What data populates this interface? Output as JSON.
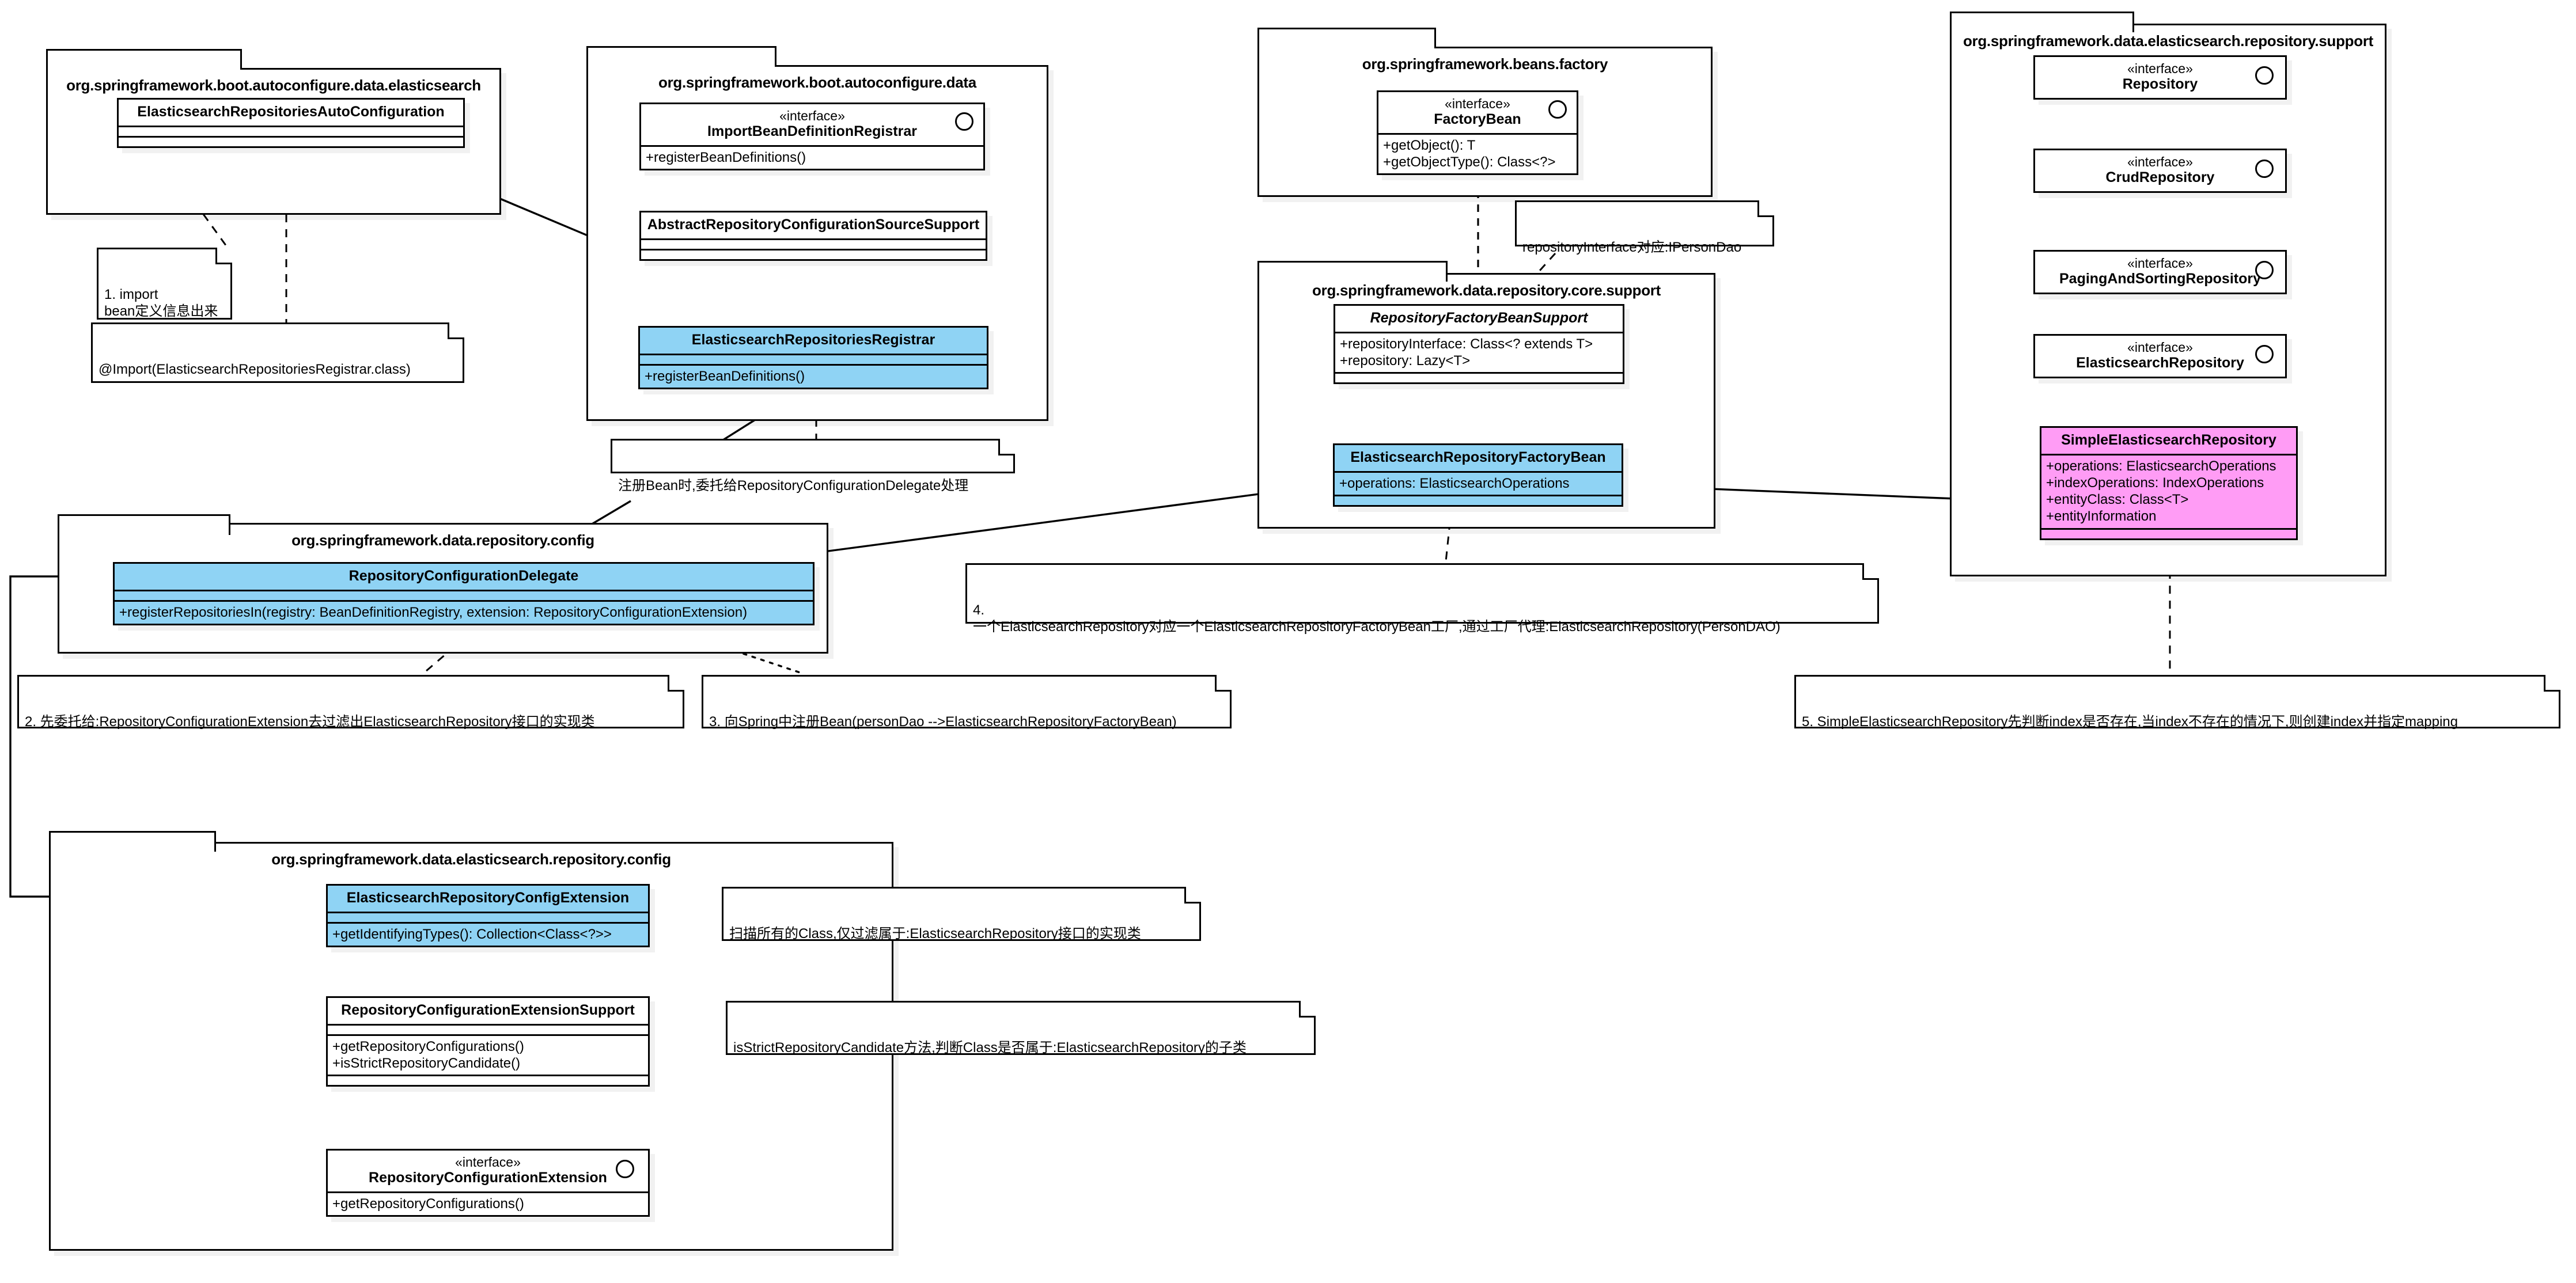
{
  "diagram": {
    "title": "Spring Data Elasticsearch Repository Registration Flow",
    "colors": {
      "highlight_blue": "#8FD3F4",
      "highlight_pink": "#FF9CF5",
      "line": "#000000",
      "background": "#FFFFFF"
    }
  },
  "packages": {
    "boot_autoconfigure_data_elasticsearch": {
      "name": "org.springframework.boot.autoconfigure.data.elasticsearch"
    },
    "boot_autoconfigure_data": {
      "name": "org.springframework.boot.autoconfigure.data"
    },
    "beans_factory": {
      "name": "org.springframework.beans.factory"
    },
    "data_repository_core_support": {
      "name": "org.springframework.data.repository.core.support"
    },
    "data_elasticsearch_repository_support": {
      "name": "org.springframework.data.elasticsearch.repository.support"
    },
    "data_repository_config": {
      "name": "org.springframework.data.repository.config"
    },
    "data_elasticsearch_repository_config": {
      "name": "org.springframework.data.elasticsearch.repository.config"
    }
  },
  "classes": {
    "elasticsearch_repositories_autoconfiguration": {
      "name": "ElasticsearchRepositoriesAutoConfiguration",
      "stereotype": "",
      "attributes": [],
      "operations": []
    },
    "import_bean_definition_registrar": {
      "name": "ImportBeanDefinitionRegistrar",
      "stereotype": "«interface»",
      "operations": [
        "+registerBeanDefinitions()"
      ]
    },
    "abstract_repository_configuration_source_support": {
      "name": "AbstractRepositoryConfigurationSourceSupport",
      "stereotype": "",
      "attributes": [],
      "operations": []
    },
    "elasticsearch_repositories_registrar": {
      "name": "ElasticsearchRepositoriesRegistrar",
      "stereotype": "",
      "attributes": [],
      "operations": [
        "+registerBeanDefinitions()"
      ]
    },
    "factory_bean": {
      "name": "FactoryBean",
      "stereotype": "«interface»",
      "operations": [
        "+getObject(): T",
        "+getObjectType(): Class<?>"
      ]
    },
    "repository_factory_bean_support": {
      "name": "RepositoryFactoryBeanSupport",
      "stereotype": "",
      "attributes": [
        "+repositoryInterface: Class<? extends T>",
        "+repository: Lazy<T>"
      ],
      "operations": []
    },
    "elasticsearch_repository_factory_bean": {
      "name": "ElasticsearchRepositoryFactoryBean",
      "stereotype": "",
      "attributes": [
        "+operations: ElasticsearchOperations"
      ],
      "operations": []
    },
    "repository": {
      "name": "Repository",
      "stereotype": "«interface»"
    },
    "crud_repository": {
      "name": "CrudRepository",
      "stereotype": "«interface»"
    },
    "paging_and_sorting_repository": {
      "name": "PagingAndSortingRepository",
      "stereotype": "«interface»"
    },
    "elasticsearch_repository": {
      "name": "ElasticsearchRepository",
      "stereotype": "«interface»"
    },
    "simple_elasticsearch_repository": {
      "name": "SimpleElasticsearchRepository",
      "stereotype": "",
      "attributes": [
        "+operations: ElasticsearchOperations",
        "+indexOperations: IndexOperations",
        "+entityClass: Class<T>",
        "+entityInformation"
      ],
      "operations": []
    },
    "repository_configuration_delegate": {
      "name": "RepositoryConfigurationDelegate",
      "stereotype": "",
      "attributes": [],
      "operations": [
        "+registerRepositoriesIn(registry: BeanDefinitionRegistry, extension: RepositoryConfigurationExtension)"
      ]
    },
    "elasticsearch_repository_config_extension": {
      "name": "ElasticsearchRepositoryConfigExtension",
      "stereotype": "",
      "attributes": [],
      "operations": [
        "+getIdentifyingTypes(): Collection<Class<?>>"
      ]
    },
    "repository_configuration_extension_support": {
      "name": "RepositoryConfigurationExtensionSupport",
      "stereotype": "",
      "attributes": [],
      "operations": [
        "+getRepositoryConfigurations()",
        "+isStrictRepositoryCandidate()"
      ]
    },
    "repository_configuration_extension": {
      "name": "RepositoryConfigurationExtension",
      "stereotype": "«interface»",
      "operations": [
        "+getRepositoryConfigurations()"
      ]
    }
  },
  "notes": {
    "note_import": "1. import\nbean定义信息出来",
    "note_import_annotation": "@Import(ElasticsearchRepositoriesRegistrar.class)",
    "note_delegate": "注册Bean时,委托给RepositoryConfigurationDelegate处理",
    "note_repository_interface": "repositoryInterface对应:IPersonDao",
    "note_step2": "2. 先委托给:RepositoryConfigurationExtension去过滤出ElasticsearchRepository接口的实现类",
    "note_step3": "3. 向Spring中注册Bean(personDao -->ElasticsearchRepositoryFactoryBean)",
    "note_step4": "4.\n一个ElasticsearchRepository对应一个ElasticsearchRepositoryFactoryBean工厂,通过工厂代理:ElasticsearchRepository(PersonDAO)",
    "note_step5": "5. SimpleElasticsearchRepository先判断index是否存在,当index不存在的情况下,则创建index并指定mapping",
    "note_scan": "扫描所有的Class,仅过滤属于:ElasticsearchRepository接口的实现类",
    "note_strict": "isStrictRepositoryCandidate方法,判断Class是否属于:ElasticsearchRepository的子类"
  }
}
